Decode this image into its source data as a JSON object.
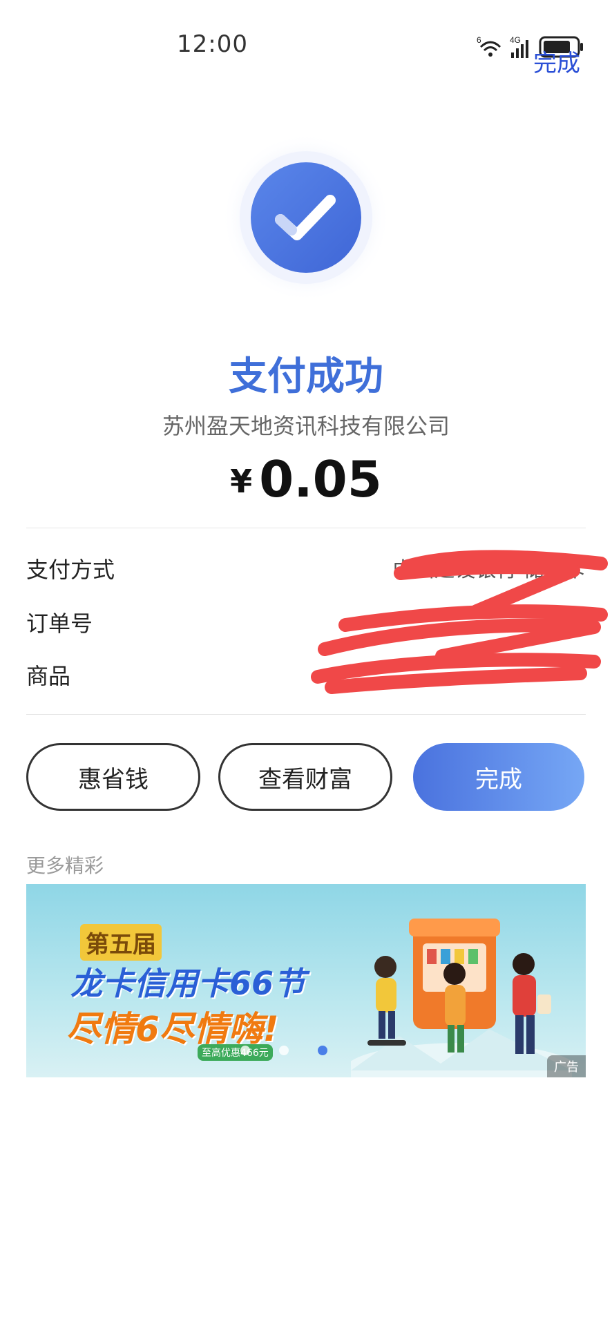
{
  "status_bar": {
    "time": "12:00",
    "network_label": "4G",
    "wifi_label": "6"
  },
  "header": {
    "done_label": "完成"
  },
  "result": {
    "title": "支付成功",
    "merchant": "苏州盈天地资讯科技有限公司",
    "currency_symbol": "¥",
    "amount": "0.05"
  },
  "details": {
    "payment_method_label": "支付方式",
    "payment_method_value": "中国建设银行 储蓄卡",
    "order_no_label": "订单号",
    "order_no_value": "",
    "goods_label": "商品",
    "goods_value": ""
  },
  "actions": {
    "save_money_label": "惠省钱",
    "view_wealth_label": "查看财富",
    "done_label": "完成"
  },
  "more": {
    "title": "更多精彩"
  },
  "banner": {
    "line1": "第五届",
    "line2": "龙卡信用卡66节",
    "line3": "尽情6尽情嗨!",
    "tag": "至高优惠466元",
    "ad_label": "广告",
    "dot_count": 3,
    "active_dot": 1
  },
  "colors": {
    "accent": "#3f6fd9",
    "done_text": "#2a4fd6",
    "redaction": "#f04848"
  }
}
